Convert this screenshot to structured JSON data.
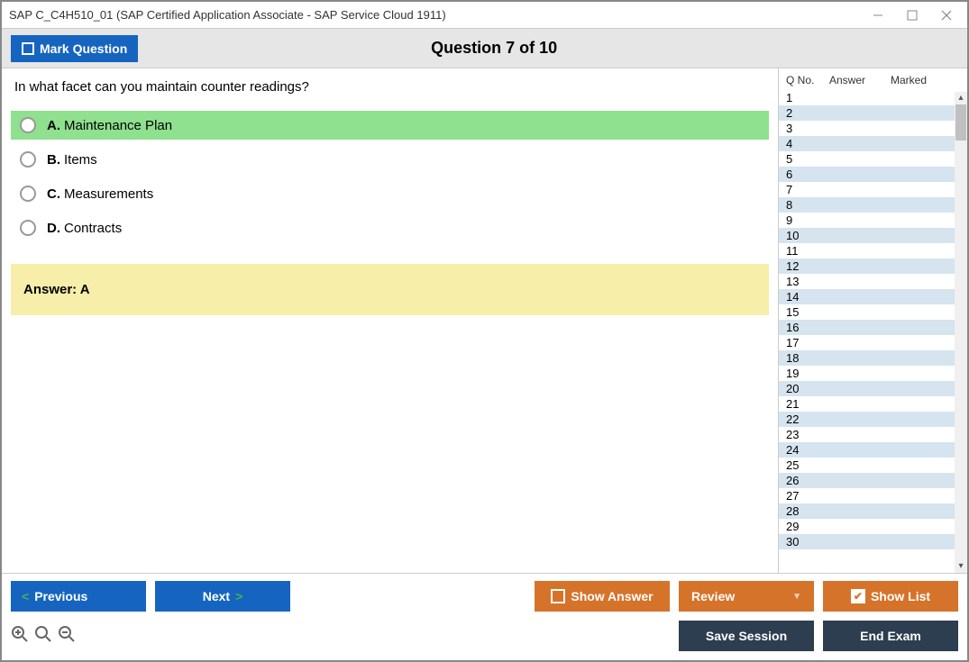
{
  "window": {
    "title": "SAP C_C4H510_01 (SAP Certified Application Associate - SAP Service Cloud 1911)"
  },
  "topbar": {
    "mark_label": "Mark Question",
    "question_title": "Question 7 of 10"
  },
  "question": {
    "text": "In what facet can you maintain counter readings?",
    "options": [
      {
        "letter": "A.",
        "text": "Maintenance Plan",
        "selected": true
      },
      {
        "letter": "B.",
        "text": "Items",
        "selected": false
      },
      {
        "letter": "C.",
        "text": "Measurements",
        "selected": false
      },
      {
        "letter": "D.",
        "text": "Contracts",
        "selected": false
      }
    ],
    "answer_label": "Answer: A"
  },
  "sidebar": {
    "header": {
      "qno": "Q No.",
      "answer": "Answer",
      "marked": "Marked"
    },
    "rows": [
      {
        "q": "1"
      },
      {
        "q": "2"
      },
      {
        "q": "3"
      },
      {
        "q": "4"
      },
      {
        "q": "5"
      },
      {
        "q": "6"
      },
      {
        "q": "7"
      },
      {
        "q": "8"
      },
      {
        "q": "9"
      },
      {
        "q": "10"
      },
      {
        "q": "11"
      },
      {
        "q": "12"
      },
      {
        "q": "13"
      },
      {
        "q": "14"
      },
      {
        "q": "15"
      },
      {
        "q": "16"
      },
      {
        "q": "17"
      },
      {
        "q": "18"
      },
      {
        "q": "19"
      },
      {
        "q": "20"
      },
      {
        "q": "21"
      },
      {
        "q": "22"
      },
      {
        "q": "23"
      },
      {
        "q": "24"
      },
      {
        "q": "25"
      },
      {
        "q": "26"
      },
      {
        "q": "27"
      },
      {
        "q": "28"
      },
      {
        "q": "29"
      },
      {
        "q": "30"
      }
    ]
  },
  "footer": {
    "previous": "Previous",
    "next": "Next",
    "show_answer": "Show Answer",
    "review": "Review",
    "show_list": "Show List",
    "save_session": "Save Session",
    "end_exam": "End Exam"
  }
}
